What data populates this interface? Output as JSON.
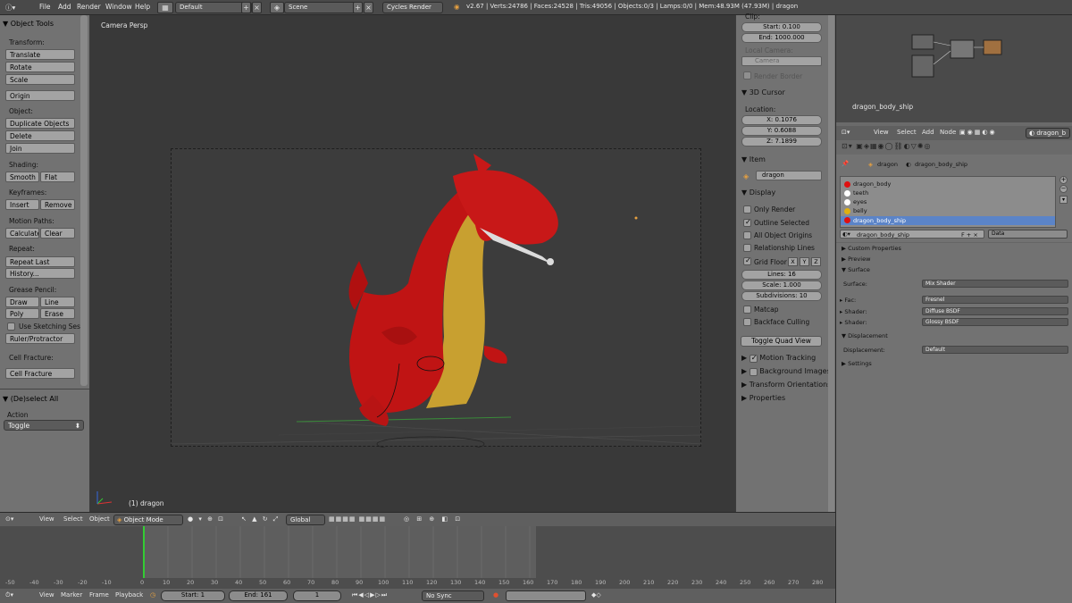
{
  "topbar": {
    "menus": [
      "File",
      "Add",
      "Render",
      "Window",
      "Help"
    ],
    "layout": "Default",
    "scene": "Scene",
    "engine": "Cycles Render",
    "stats": "v2.67 | Verts:24786 | Faces:24528 | Tris:49056 | Objects:0/3 | Lamps:0/0 | Mem:48.93M (47.93M) | dragon"
  },
  "toolshelf": {
    "title": "Object Tools",
    "transform_label": "Transform:",
    "translate": "Translate",
    "rotate": "Rotate",
    "scale": "Scale",
    "origin": "Origin",
    "object_label": "Object:",
    "duplicate": "Duplicate Objects",
    "delete": "Delete",
    "join": "Join",
    "shading_label": "Shading:",
    "smooth": "Smooth",
    "flat": "Flat",
    "keyframes_label": "Keyframes:",
    "insert": "Insert",
    "remove": "Remove",
    "motion_label": "Motion Paths:",
    "calculate": "Calculate",
    "clear": "Clear",
    "repeat_label": "Repeat:",
    "repeat_last": "Repeat Last",
    "history": "History...",
    "grease_label": "Grease Pencil:",
    "draw": "Draw",
    "line": "Line",
    "poly": "Poly",
    "erase": "Erase",
    "use_sketching": "Use Sketching Ses",
    "ruler": "Ruler/Protractor",
    "cell_label": "Cell Fracture:",
    "cell_fracture": "Cell Fracture",
    "deselect_all": "(De)select All",
    "action_label": "Action",
    "action_value": "Toggle"
  },
  "viewport": {
    "camera_label": "Camera Persp",
    "object_label": "(1) dragon"
  },
  "npanel": {
    "clip_label": "Clip:",
    "start": "Start: 0.100",
    "end": "End: 1000.000",
    "local_camera": "Local Camera:",
    "camera": "Camera",
    "render_border": "Render Border",
    "cursor_hdr": "3D Cursor",
    "location_label": "Location:",
    "x": "X: 0.1076",
    "y": "Y: 0.6088",
    "z": "Z: 7.1899",
    "item_hdr": "Item",
    "item_name": "dragon",
    "display_hdr": "Display",
    "only_render": "Only Render",
    "outline_selected": "Outline Selected",
    "all_origins": "All Object Origins",
    "relationship": "Relationship Lines",
    "grid_floor": "Grid Floor",
    "gx": "X",
    "gy": "Y",
    "gz": "Z",
    "lines": "Lines: 16",
    "grid_scale": "Scale: 1.000",
    "subdivisions": "Subdivisions: 10",
    "matcap": "Matcap",
    "backface": "Backface Culling",
    "toggle_quad": "Toggle Quad View",
    "motion_tracking": "Motion Tracking",
    "bg_images": "Background Images",
    "transform_orient": "Transform Orientations",
    "properties": "Properties"
  },
  "nodeeditor": {
    "material_name": "dragon_body_ship"
  },
  "props": {
    "header_menus": [
      "View",
      "Select",
      "Add",
      "Node"
    ],
    "header_field": "dragon_b",
    "breadcrumb_obj": "dragon",
    "breadcrumb_mat": "dragon_body_ship",
    "materials": [
      {
        "name": "dragon_body",
        "color": "#e01010"
      },
      {
        "name": "teeth",
        "color": "#ffffff"
      },
      {
        "name": "eyes",
        "color": "#ffffff"
      },
      {
        "name": "belly",
        "color": "#e0b010"
      },
      {
        "name": "dragon_body_ship",
        "color": "#e01010"
      }
    ],
    "mat_field": "dragon_body_ship",
    "data_field": "Data",
    "custom_props": "Custom Properties",
    "preview": "Preview",
    "surface": "Surface",
    "surface_label": "Surface:",
    "surface_value": "Mix Shader",
    "fac_label": "Fac:",
    "fac_value": "Fresnel",
    "shader1_label": "Shader:",
    "shader1_value": "Diffuse BSDF",
    "shader2_label": "Shader:",
    "shader2_value": "Glossy BSDF",
    "displacement_hdr": "Displacement",
    "displacement_label": "Displacement:",
    "displacement_value": "Default",
    "settings": "Settings"
  },
  "vphdr": {
    "view": "View",
    "select": "Select",
    "object": "Object",
    "mode": "Object Mode",
    "orientation": "Global"
  },
  "timeline": {
    "ticks": [
      "-50",
      "-40",
      "-30",
      "-20",
      "-10",
      "0",
      "10",
      "20",
      "30",
      "40",
      "50",
      "60",
      "70",
      "80",
      "90",
      "100",
      "110",
      "120",
      "130",
      "140",
      "150",
      "160",
      "170",
      "180",
      "190",
      "200",
      "210",
      "220",
      "230",
      "240",
      "250",
      "260",
      "270",
      "280"
    ],
    "view": "View",
    "marker": "Marker",
    "frame": "Frame",
    "playback": "Playback",
    "start": "Start: 1",
    "end": "End: 161",
    "current": "1",
    "sync": "No Sync"
  }
}
